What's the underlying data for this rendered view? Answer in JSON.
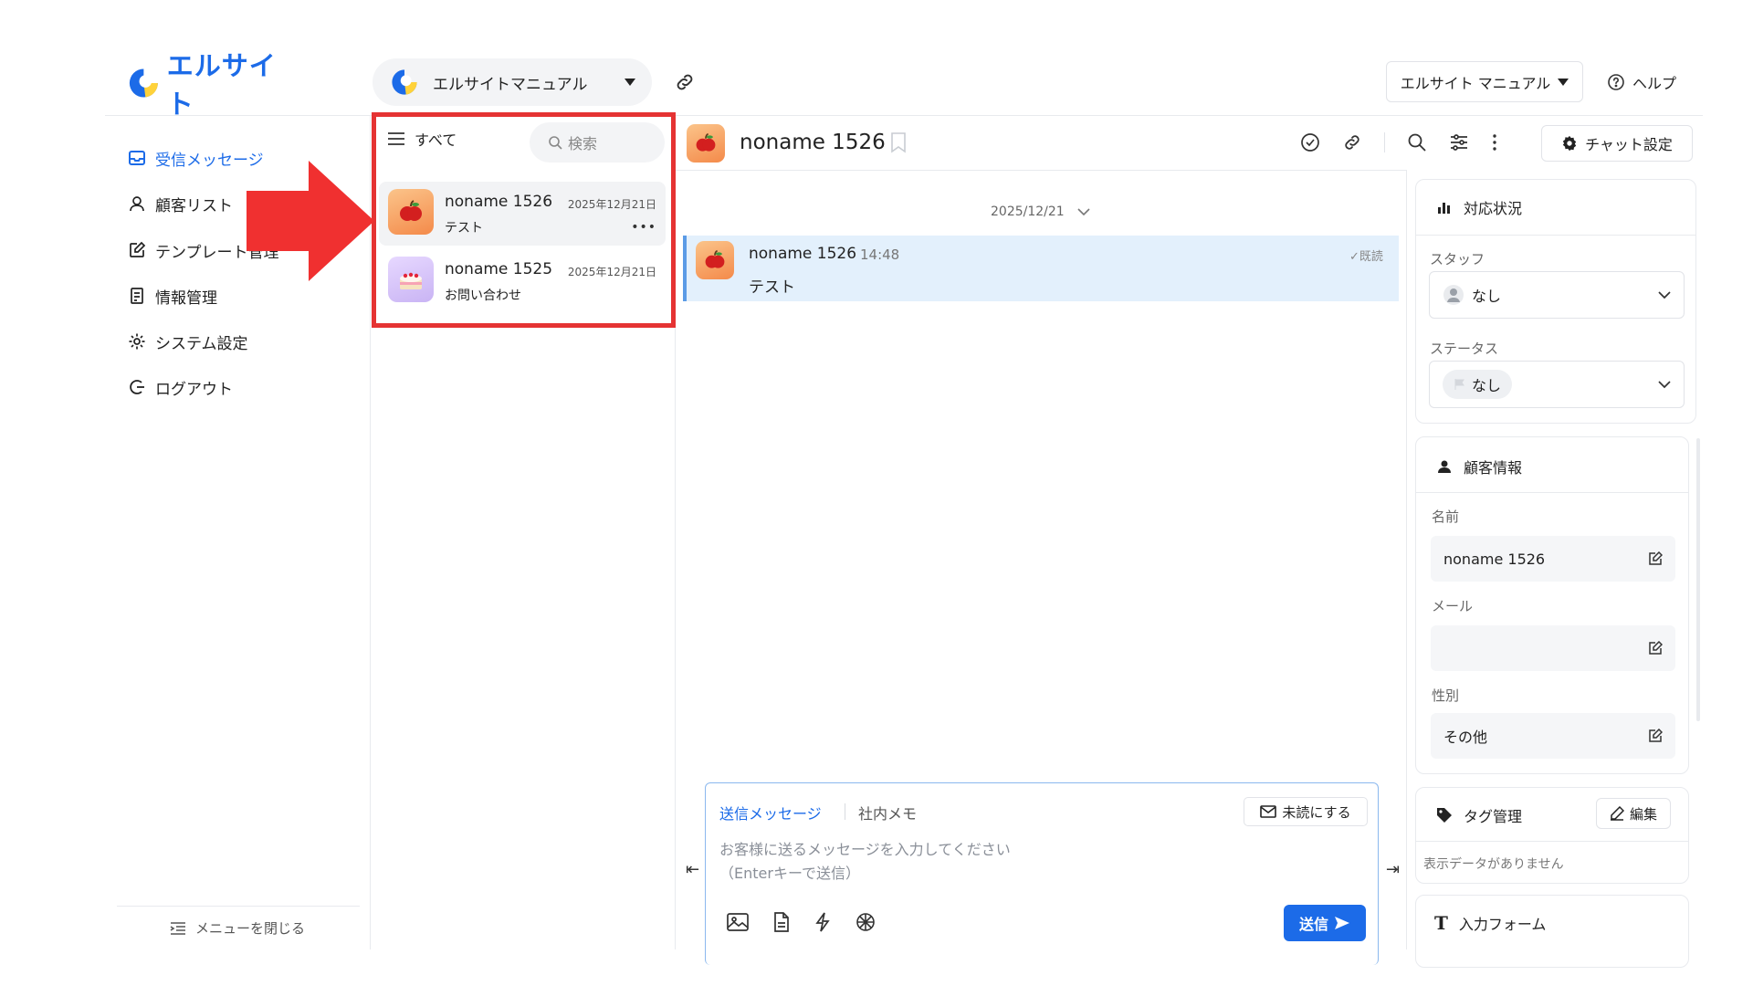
{
  "header": {
    "logo_text": "エルサイト",
    "account_name": "エルサイトマニュアル",
    "account_dropdown": "エルサイト マニュアル",
    "help_label": "ヘルプ"
  },
  "sidebar": {
    "items": [
      {
        "label": "受信メッセージ",
        "icon": "inbox-icon",
        "active": true
      },
      {
        "label": "顧客リスト",
        "icon": "user-icon"
      },
      {
        "label": "テンプレート管理",
        "icon": "edit-icon"
      },
      {
        "label": "情報管理",
        "icon": "document-icon"
      },
      {
        "label": "システム設定",
        "icon": "gear-icon"
      },
      {
        "label": "ログアウト",
        "icon": "logout-icon"
      }
    ],
    "close_menu": "メニューを閉じる"
  },
  "conversation_list": {
    "filter_label": "すべて",
    "search_placeholder": "検索",
    "items": [
      {
        "name": "noname 1526",
        "date": "2025年12月21日",
        "preview": "テスト",
        "avatar": "apple-icon",
        "selected": true
      },
      {
        "name": "noname 1525",
        "date": "2025年12月21日",
        "preview": "お問い合わせ",
        "avatar": "cake-icon",
        "selected": false
      }
    ]
  },
  "chat": {
    "title": "noname 1526",
    "settings_label": "チャット設定",
    "date_separator": "2025/12/21",
    "messages": [
      {
        "sender": "noname 1526",
        "time": "14:48",
        "read": "既読",
        "text": "テスト"
      }
    ]
  },
  "composer": {
    "tab_send": "送信メッセージ",
    "tab_memo": "社内メモ",
    "unread_label": "未読にする",
    "placeholder": "お客様に送るメッセージを入力してください\n（Enterキーで送信）",
    "send_label": "送信"
  },
  "right_panel": {
    "status_card": {
      "title": "対応状況",
      "staff_label": "スタッフ",
      "staff_value": "なし",
      "status_label": "ステータス",
      "status_value": "なし"
    },
    "customer_card": {
      "title": "顧客情報",
      "name_label": "名前",
      "name_value": "noname 1526",
      "email_label": "メール",
      "email_value": "",
      "gender_label": "性別",
      "gender_value": "その他"
    },
    "tag_card": {
      "title": "タグ管理",
      "edit_label": "編集",
      "empty_text": "表示データがありません"
    },
    "form_card": {
      "title": "入力フォーム"
    }
  },
  "colors": {
    "brand": "#1c6be8",
    "highlight": "#e53333",
    "message_bg": "#e3f0fc"
  }
}
